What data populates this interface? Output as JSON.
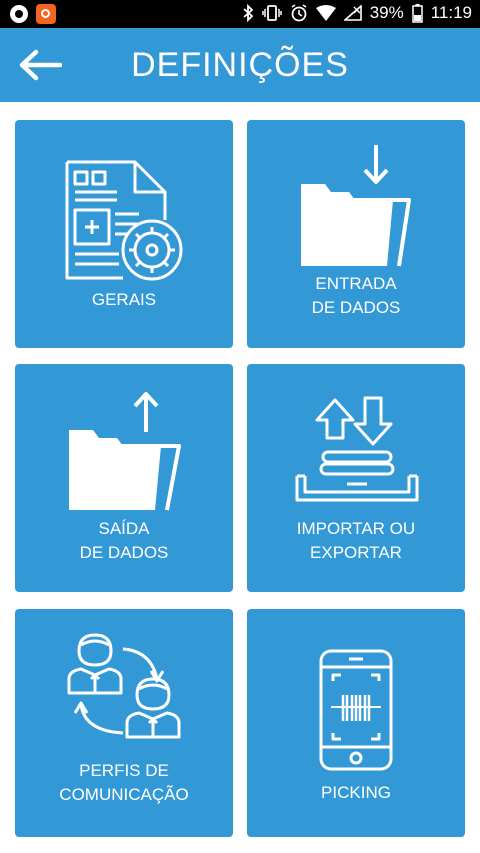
{
  "status_bar": {
    "battery": "39%",
    "time": "11:19"
  },
  "header": {
    "title": "DEFINIÇÕES"
  },
  "tiles": [
    {
      "label": "GERAIS",
      "icon": "settings-document-icon"
    },
    {
      "label": "ENTRADA\nDE DADOS",
      "icon": "folder-download-icon"
    },
    {
      "label": "SAÍDA\nDE DADOS",
      "icon": "folder-upload-icon"
    },
    {
      "label": "IMPORTAR OU\nEXPORTAR",
      "icon": "import-export-icon"
    },
    {
      "label": "PERFIS DE\nCOMUNICAÇÃO",
      "icon": "communication-profiles-icon"
    },
    {
      "label": "PICKING",
      "icon": "phone-barcode-icon"
    }
  ],
  "colors": {
    "accent": "#3399d6",
    "status_bar": "#000000",
    "background": "#ffffff"
  }
}
